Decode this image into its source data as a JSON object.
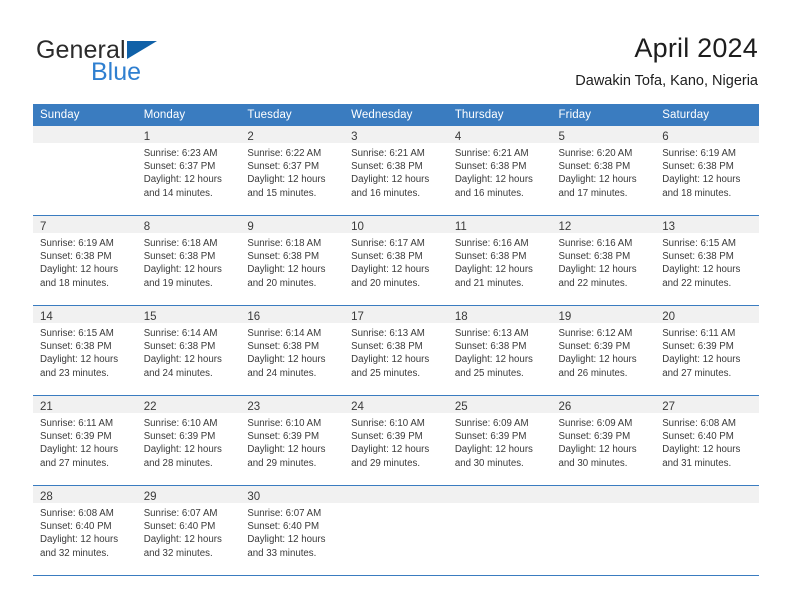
{
  "brand": {
    "name_part1": "General",
    "name_part2": "Blue",
    "accent_color": "#1061a8",
    "blue_text_color": "#2f7fd0"
  },
  "header": {
    "title": "April 2024",
    "subtitle": "Dawakin Tofa, Kano, Nigeria"
  },
  "calendar": {
    "header_bg": "#3a7cc0",
    "daynum_bg": "#f1f1f1",
    "weekday_headers": [
      "Sunday",
      "Monday",
      "Tuesday",
      "Wednesday",
      "Thursday",
      "Friday",
      "Saturday"
    ],
    "weeks": [
      [
        {
          "day": "",
          "sunrise": "",
          "sunset": "",
          "daylight_line1": "",
          "daylight_line2": ""
        },
        {
          "day": "1",
          "sunrise": "Sunrise: 6:23 AM",
          "sunset": "Sunset: 6:37 PM",
          "daylight_line1": "Daylight: 12 hours",
          "daylight_line2": "and 14 minutes."
        },
        {
          "day": "2",
          "sunrise": "Sunrise: 6:22 AM",
          "sunset": "Sunset: 6:37 PM",
          "daylight_line1": "Daylight: 12 hours",
          "daylight_line2": "and 15 minutes."
        },
        {
          "day": "3",
          "sunrise": "Sunrise: 6:21 AM",
          "sunset": "Sunset: 6:38 PM",
          "daylight_line1": "Daylight: 12 hours",
          "daylight_line2": "and 16 minutes."
        },
        {
          "day": "4",
          "sunrise": "Sunrise: 6:21 AM",
          "sunset": "Sunset: 6:38 PM",
          "daylight_line1": "Daylight: 12 hours",
          "daylight_line2": "and 16 minutes."
        },
        {
          "day": "5",
          "sunrise": "Sunrise: 6:20 AM",
          "sunset": "Sunset: 6:38 PM",
          "daylight_line1": "Daylight: 12 hours",
          "daylight_line2": "and 17 minutes."
        },
        {
          "day": "6",
          "sunrise": "Sunrise: 6:19 AM",
          "sunset": "Sunset: 6:38 PM",
          "daylight_line1": "Daylight: 12 hours",
          "daylight_line2": "and 18 minutes."
        }
      ],
      [
        {
          "day": "7",
          "sunrise": "Sunrise: 6:19 AM",
          "sunset": "Sunset: 6:38 PM",
          "daylight_line1": "Daylight: 12 hours",
          "daylight_line2": "and 18 minutes."
        },
        {
          "day": "8",
          "sunrise": "Sunrise: 6:18 AM",
          "sunset": "Sunset: 6:38 PM",
          "daylight_line1": "Daylight: 12 hours",
          "daylight_line2": "and 19 minutes."
        },
        {
          "day": "9",
          "sunrise": "Sunrise: 6:18 AM",
          "sunset": "Sunset: 6:38 PM",
          "daylight_line1": "Daylight: 12 hours",
          "daylight_line2": "and 20 minutes."
        },
        {
          "day": "10",
          "sunrise": "Sunrise: 6:17 AM",
          "sunset": "Sunset: 6:38 PM",
          "daylight_line1": "Daylight: 12 hours",
          "daylight_line2": "and 20 minutes."
        },
        {
          "day": "11",
          "sunrise": "Sunrise: 6:16 AM",
          "sunset": "Sunset: 6:38 PM",
          "daylight_line1": "Daylight: 12 hours",
          "daylight_line2": "and 21 minutes."
        },
        {
          "day": "12",
          "sunrise": "Sunrise: 6:16 AM",
          "sunset": "Sunset: 6:38 PM",
          "daylight_line1": "Daylight: 12 hours",
          "daylight_line2": "and 22 minutes."
        },
        {
          "day": "13",
          "sunrise": "Sunrise: 6:15 AM",
          "sunset": "Sunset: 6:38 PM",
          "daylight_line1": "Daylight: 12 hours",
          "daylight_line2": "and 22 minutes."
        }
      ],
      [
        {
          "day": "14",
          "sunrise": "Sunrise: 6:15 AM",
          "sunset": "Sunset: 6:38 PM",
          "daylight_line1": "Daylight: 12 hours",
          "daylight_line2": "and 23 minutes."
        },
        {
          "day": "15",
          "sunrise": "Sunrise: 6:14 AM",
          "sunset": "Sunset: 6:38 PM",
          "daylight_line1": "Daylight: 12 hours",
          "daylight_line2": "and 24 minutes."
        },
        {
          "day": "16",
          "sunrise": "Sunrise: 6:14 AM",
          "sunset": "Sunset: 6:38 PM",
          "daylight_line1": "Daylight: 12 hours",
          "daylight_line2": "and 24 minutes."
        },
        {
          "day": "17",
          "sunrise": "Sunrise: 6:13 AM",
          "sunset": "Sunset: 6:38 PM",
          "daylight_line1": "Daylight: 12 hours",
          "daylight_line2": "and 25 minutes."
        },
        {
          "day": "18",
          "sunrise": "Sunrise: 6:13 AM",
          "sunset": "Sunset: 6:38 PM",
          "daylight_line1": "Daylight: 12 hours",
          "daylight_line2": "and 25 minutes."
        },
        {
          "day": "19",
          "sunrise": "Sunrise: 6:12 AM",
          "sunset": "Sunset: 6:39 PM",
          "daylight_line1": "Daylight: 12 hours",
          "daylight_line2": "and 26 minutes."
        },
        {
          "day": "20",
          "sunrise": "Sunrise: 6:11 AM",
          "sunset": "Sunset: 6:39 PM",
          "daylight_line1": "Daylight: 12 hours",
          "daylight_line2": "and 27 minutes."
        }
      ],
      [
        {
          "day": "21",
          "sunrise": "Sunrise: 6:11 AM",
          "sunset": "Sunset: 6:39 PM",
          "daylight_line1": "Daylight: 12 hours",
          "daylight_line2": "and 27 minutes."
        },
        {
          "day": "22",
          "sunrise": "Sunrise: 6:10 AM",
          "sunset": "Sunset: 6:39 PM",
          "daylight_line1": "Daylight: 12 hours",
          "daylight_line2": "and 28 minutes."
        },
        {
          "day": "23",
          "sunrise": "Sunrise: 6:10 AM",
          "sunset": "Sunset: 6:39 PM",
          "daylight_line1": "Daylight: 12 hours",
          "daylight_line2": "and 29 minutes."
        },
        {
          "day": "24",
          "sunrise": "Sunrise: 6:10 AM",
          "sunset": "Sunset: 6:39 PM",
          "daylight_line1": "Daylight: 12 hours",
          "daylight_line2": "and 29 minutes."
        },
        {
          "day": "25",
          "sunrise": "Sunrise: 6:09 AM",
          "sunset": "Sunset: 6:39 PM",
          "daylight_line1": "Daylight: 12 hours",
          "daylight_line2": "and 30 minutes."
        },
        {
          "day": "26",
          "sunrise": "Sunrise: 6:09 AM",
          "sunset": "Sunset: 6:39 PM",
          "daylight_line1": "Daylight: 12 hours",
          "daylight_line2": "and 30 minutes."
        },
        {
          "day": "27",
          "sunrise": "Sunrise: 6:08 AM",
          "sunset": "Sunset: 6:40 PM",
          "daylight_line1": "Daylight: 12 hours",
          "daylight_line2": "and 31 minutes."
        }
      ],
      [
        {
          "day": "28",
          "sunrise": "Sunrise: 6:08 AM",
          "sunset": "Sunset: 6:40 PM",
          "daylight_line1": "Daylight: 12 hours",
          "daylight_line2": "and 32 minutes."
        },
        {
          "day": "29",
          "sunrise": "Sunrise: 6:07 AM",
          "sunset": "Sunset: 6:40 PM",
          "daylight_line1": "Daylight: 12 hours",
          "daylight_line2": "and 32 minutes."
        },
        {
          "day": "30",
          "sunrise": "Sunrise: 6:07 AM",
          "sunset": "Sunset: 6:40 PM",
          "daylight_line1": "Daylight: 12 hours",
          "daylight_line2": "and 33 minutes."
        },
        {
          "day": "",
          "sunrise": "",
          "sunset": "",
          "daylight_line1": "",
          "daylight_line2": ""
        },
        {
          "day": "",
          "sunrise": "",
          "sunset": "",
          "daylight_line1": "",
          "daylight_line2": ""
        },
        {
          "day": "",
          "sunrise": "",
          "sunset": "",
          "daylight_line1": "",
          "daylight_line2": ""
        },
        {
          "day": "",
          "sunrise": "",
          "sunset": "",
          "daylight_line1": "",
          "daylight_line2": ""
        }
      ]
    ]
  }
}
